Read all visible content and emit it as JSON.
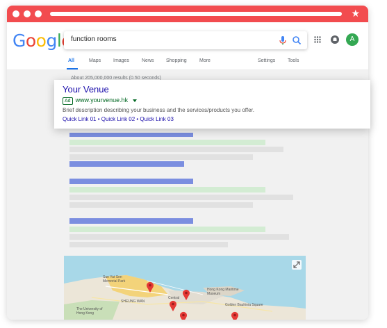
{
  "browser": {
    "accent": "#f24c4f"
  },
  "google": {
    "logo_letters": [
      {
        "ch": "G",
        "color": "#4285f4"
      },
      {
        "ch": "o",
        "color": "#ea4335"
      },
      {
        "ch": "o",
        "color": "#fbbc05"
      },
      {
        "ch": "g",
        "color": "#4285f4"
      },
      {
        "ch": "l",
        "color": "#34a853"
      },
      {
        "ch": "e",
        "color": "#ea4335"
      }
    ],
    "query": "function rooms",
    "avatar_initial": "A",
    "tabs": [
      "All",
      "Maps",
      "Images",
      "News",
      "Shopping",
      "More"
    ],
    "settings_label": "Settings",
    "tools_label": "Tools",
    "result_stats": "About 205,000,000 results (0.50 seconds)"
  },
  "ad": {
    "title": "Your Venue",
    "badge": "Ad",
    "url": "www.yourvenue.hk",
    "description": "Brief description describing your business and the services/products you offer.",
    "quick_links": "Quick Link 01 • Quick Link 02 • Quick Link 03"
  },
  "map": {
    "labels": [
      "Sun Yat Sen Memorial Park",
      "SHEUNG WAN",
      "Central",
      "Hong Kong Maritime Museum",
      "Golden Bauhinia Square",
      "The University of Hong Kong"
    ]
  }
}
